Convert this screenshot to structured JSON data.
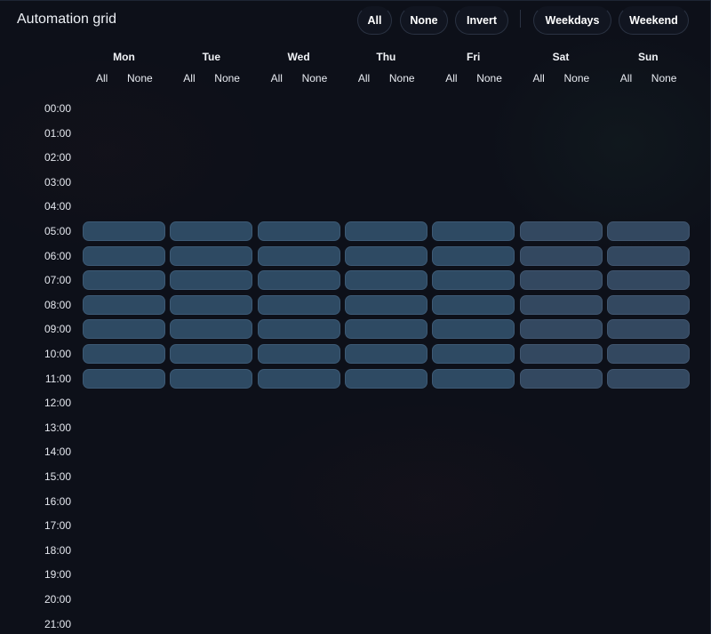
{
  "title": "Automation grid",
  "toolbar": {
    "all": "All",
    "none": "None",
    "invert": "Invert",
    "weekdays": "Weekdays",
    "weekend": "Weekend"
  },
  "column_controls": {
    "all": "All",
    "none": "None"
  },
  "days": [
    "Mon",
    "Tue",
    "Wed",
    "Thu",
    "Fri",
    "Sat",
    "Sun"
  ],
  "hours": [
    "00:00",
    "01:00",
    "02:00",
    "03:00",
    "04:00",
    "05:00",
    "06:00",
    "07:00",
    "08:00",
    "09:00",
    "10:00",
    "11:00",
    "12:00",
    "13:00",
    "14:00",
    "15:00",
    "16:00",
    "17:00",
    "18:00",
    "19:00",
    "20:00",
    "21:00"
  ],
  "selected_hours": [
    "05:00",
    "06:00",
    "07:00",
    "08:00",
    "09:00",
    "10:00",
    "11:00"
  ],
  "colors": {
    "selected_cell": "#2e4a63",
    "background": "#0d1019"
  }
}
